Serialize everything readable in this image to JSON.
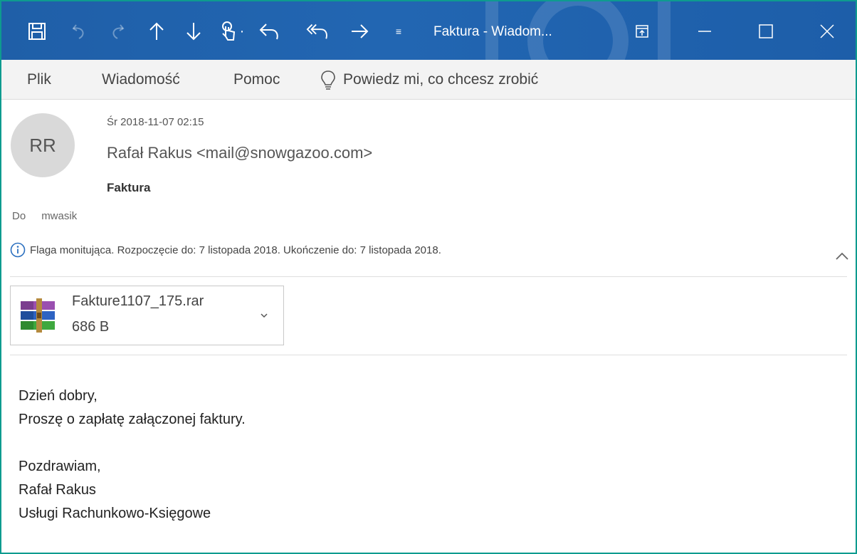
{
  "window": {
    "title": "Faktura  -  Wiadom...",
    "colors": {
      "titlebar": "#2264b0",
      "frame": "#0e9b8f"
    }
  },
  "toolbar": {
    "icons": [
      "save-icon",
      "undo-icon",
      "redo-icon",
      "previous-item-icon",
      "next-item-icon",
      "touch-mode-icon",
      "reply-icon",
      "reply-all-icon",
      "forward-icon",
      "customize-dropdown-icon"
    ],
    "touch_dropdown": "·",
    "customize": "≡"
  },
  "menu": {
    "items": [
      "Plik",
      "Wiadomość",
      "Pomoc"
    ],
    "tell_me": "Powiedz mi, co chcesz zrobić"
  },
  "message": {
    "avatar_initials": "RR",
    "date": "Śr 2018-11-07 02:15",
    "sender": "Rafał Rakus <mail@snowgazoo.com>",
    "subject": "Faktura",
    "to_label": "Do",
    "to_value": "mwasik",
    "flag_info": "Flaga monitująca.  Rozpoczęcie do: 7 listopada 2018.  Ukończenie do: 7 listopada 2018."
  },
  "attachment": {
    "name": "Fakture1107_175.rar",
    "size": "686 B",
    "icon": "winrar-archive-icon"
  },
  "body": {
    "lines_1": [
      "Dzień dobry,",
      "Proszę o zapłatę załączonej faktury."
    ],
    "lines_2": [
      "Pozdrawiam,",
      "Rafał Rakus",
      "Usługi Rachunkowo-Księgowe"
    ]
  }
}
